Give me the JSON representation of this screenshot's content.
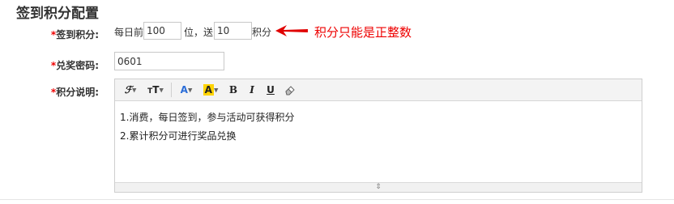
{
  "page_title": "签到积分配置",
  "signin_points": {
    "label": "签到积分:",
    "required_mark": "*",
    "prefix": "每日前",
    "count_value": "100",
    "middle": "位，送",
    "points_value": "10",
    "suffix": "积分",
    "note": "积分只能是正整数",
    "note_color": "#e00000"
  },
  "redeem_password": {
    "label": "兑奖密码:",
    "required_mark": "*",
    "value": "0601"
  },
  "points_description": {
    "label": "积分说明:",
    "required_mark": "*",
    "toolbar": {
      "font_family_icon": "font-family-icon",
      "font_size_icon": "font-size-icon",
      "font_color_label": "A",
      "highlight_label": "A",
      "highlight_color": "#ffd400",
      "bold_label": "B",
      "italic_label": "I",
      "underline_label": "U",
      "clear_format_icon": "eraser-icon"
    },
    "lines": [
      "1.消费，每日签到，参与活动可获得积分",
      "2.累计积分可进行奖品兑换"
    ]
  }
}
